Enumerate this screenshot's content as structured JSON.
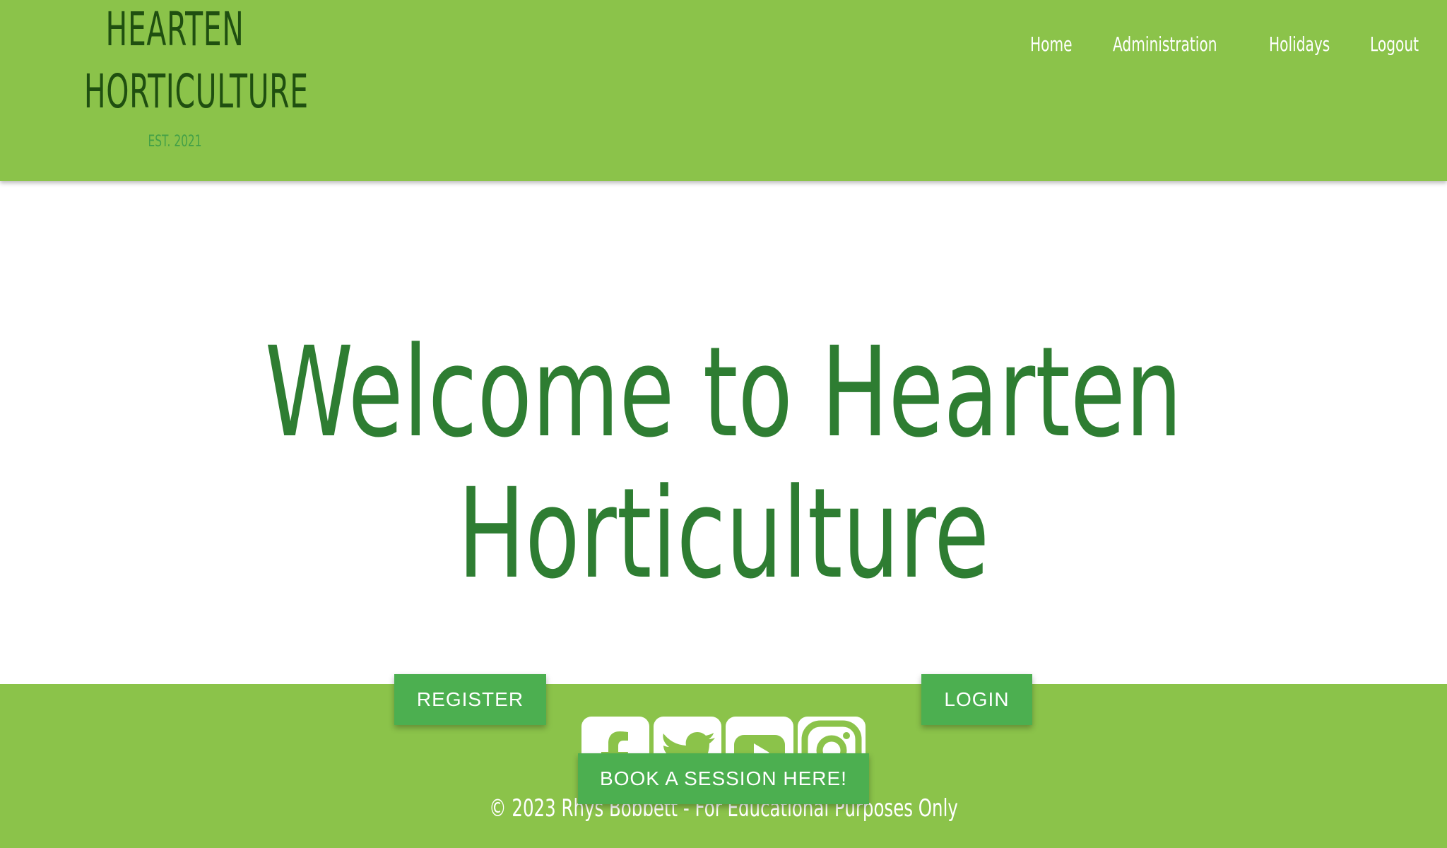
{
  "brand": {
    "name_line1": "HEARTEN",
    "name_line2": "HORTICULTURE",
    "established": "EST. 2021"
  },
  "nav": {
    "items": [
      {
        "label": "Home"
      },
      {
        "label": "Administration"
      },
      {
        "label": "Holidays"
      },
      {
        "label": "Logout"
      }
    ]
  },
  "hero": {
    "title_line1": "Welcome to Hearten",
    "title_line2": "Horticulture"
  },
  "buttons": {
    "register": "REGISTER",
    "login": "LOGIN",
    "book": "BOOK A SESSION HERE!"
  },
  "footer": {
    "socials": [
      {
        "icon": "facebook-icon"
      },
      {
        "icon": "twitter-icon"
      },
      {
        "icon": "youtube-icon"
      },
      {
        "icon": "instagram-icon"
      }
    ],
    "copyright": "© 2023 Rhys Bobbett - For Educational Purposes Only"
  },
  "colors": {
    "header_bg": "#8bc34a",
    "accent_green": "#4caf50",
    "title_green": "#2e7d32",
    "logo_dark": "#1f4f10"
  }
}
